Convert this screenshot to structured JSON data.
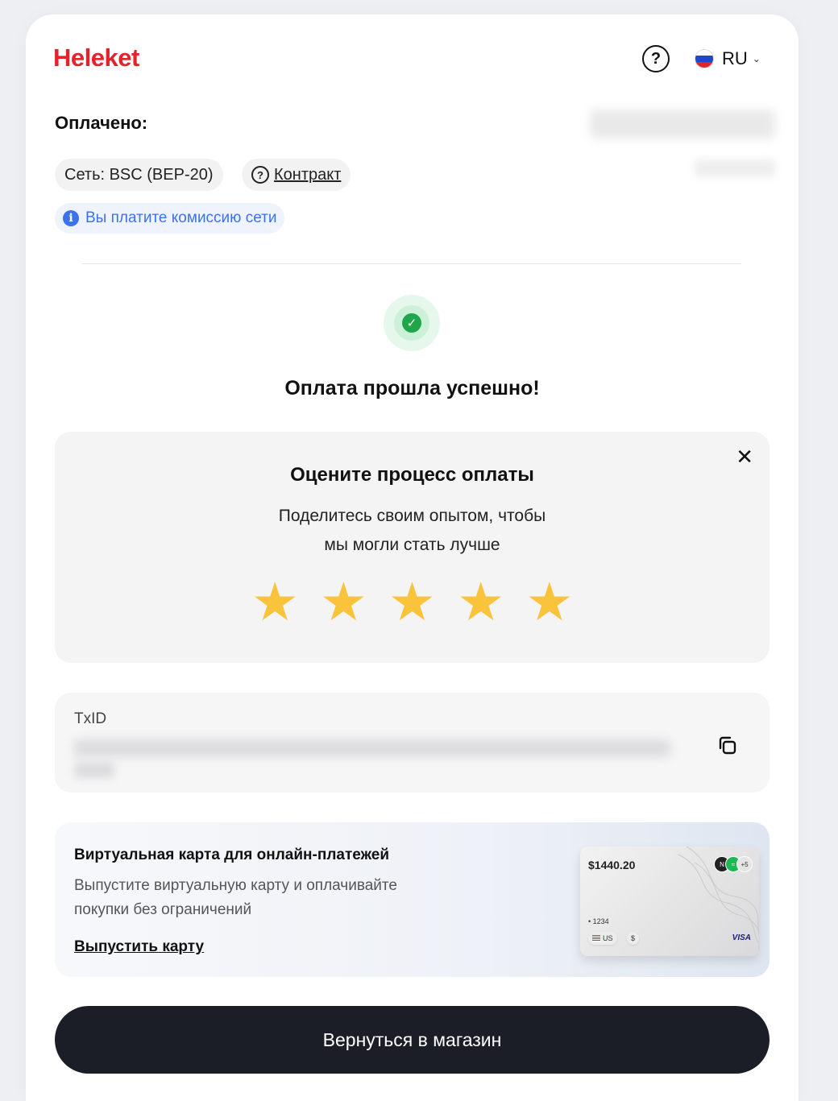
{
  "header": {
    "logo": "Heleket",
    "help_icon": "question-circle-icon",
    "lang": {
      "code": "RU",
      "flag_icon": "russia-flag-icon",
      "chevron": "chevron-down-icon"
    }
  },
  "payment": {
    "paid_label": "Оплачено:",
    "network_chip": "Сеть: BSC (BEP-20)",
    "contract_label": "Контракт",
    "fee_note": "Вы платите комиссию сети"
  },
  "status": {
    "title": "Оплата прошла успешно!",
    "icon": "check-circle-icon",
    "color": "#1fa64b"
  },
  "rating": {
    "title": "Оцените процесс оплаты",
    "subtitle_line1": "Поделитесь своим опытом, чтобы",
    "subtitle_line2": "мы могли стать лучше",
    "stars": 5,
    "star_color": "#f9c33c"
  },
  "transaction": {
    "label": "TxID",
    "copy_icon": "copy-icon"
  },
  "promo": {
    "title": "Виртуальная карта для онлайн-платежей",
    "text": "Выпустите виртуальную карту и оплачивайте покупки без ограничений",
    "link": "Выпустить карту",
    "card": {
      "amount": "$1440.20",
      "extra_services": "+5",
      "last4": "• 1234",
      "country": "US",
      "currency": "$",
      "network": "VISA"
    }
  },
  "footer": {
    "back_button": "Вернуться в магазин"
  },
  "colors": {
    "brand": "#e2232b",
    "info": "#3b74ea",
    "button_bg": "#1b1e26"
  }
}
